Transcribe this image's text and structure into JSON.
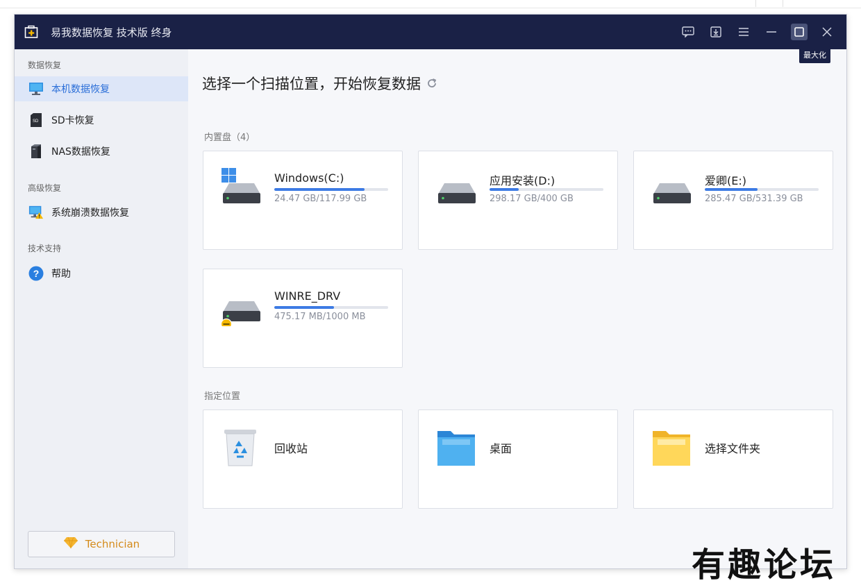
{
  "app": {
    "title": "易我数据恢复 技术版 终身",
    "tooltip": "最大化"
  },
  "sidebar": {
    "section1": "数据恢复",
    "section2": "高级恢复",
    "section3": "技术支持",
    "items": [
      {
        "label": "本机数据恢复",
        "icon": "monitor-icon"
      },
      {
        "label": "SD卡恢复",
        "icon": "sd-card-icon"
      },
      {
        "label": "NAS数据恢复",
        "icon": "nas-icon"
      },
      {
        "label": "系统崩溃数据恢复",
        "icon": "system-crash-icon"
      },
      {
        "label": "帮助",
        "icon": "help-icon"
      }
    ],
    "technician": "Technician"
  },
  "main": {
    "title": "选择一个扫描位置，开始恢复数据",
    "internal_label": "内置盘（4）",
    "location_label": "指定位置",
    "drives": [
      {
        "name": "Windows(C:)",
        "size": "24.47 GB/117.99 GB",
        "used": 0.793
      },
      {
        "name": "应用安装(D:)",
        "size": "298.17 GB/400 GB",
        "used": 0.255
      },
      {
        "name": "爱卿(E:)",
        "size": "285.47 GB/531.39 GB",
        "used": 0.463
      },
      {
        "name": "WINRE_DRV",
        "size": "475.17 MB/1000 MB",
        "used": 0.525
      }
    ],
    "locations": [
      {
        "name": "回收站",
        "icon": "recycle-bin-icon"
      },
      {
        "name": "桌面",
        "icon": "desktop-folder-icon"
      },
      {
        "name": "选择文件夹",
        "icon": "folder-icon"
      }
    ]
  },
  "watermark": "有趣论坛",
  "colors": {
    "titlebar": "#1a2146",
    "accent": "#2a6ed8",
    "progress": "#3d7be4",
    "technician": "#d48a1a"
  }
}
